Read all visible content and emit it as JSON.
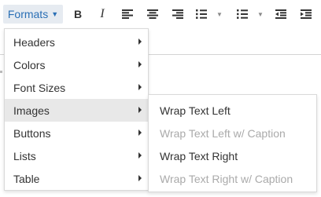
{
  "toolbar": {
    "formats_label": "Formats",
    "bold_label": "B",
    "italic_label": "I",
    "icons": [
      "align-left-icon",
      "align-center-icon",
      "align-right-icon",
      "bullet-list-icon",
      "numbered-list-icon",
      "outdent-icon",
      "indent-icon"
    ]
  },
  "menu": {
    "items": [
      {
        "label": "Headers"
      },
      {
        "label": "Colors"
      },
      {
        "label": "Font Sizes"
      },
      {
        "label": "Images"
      },
      {
        "label": "Buttons"
      },
      {
        "label": "Lists"
      },
      {
        "label": "Table"
      }
    ],
    "active_index": 3
  },
  "submenu": {
    "items": [
      {
        "label": "Wrap Text Left",
        "enabled": true
      },
      {
        "label": "Wrap Text Left w/ Caption",
        "enabled": false
      },
      {
        "label": "Wrap Text Right",
        "enabled": true
      },
      {
        "label": "Wrap Text Right w/ Caption",
        "enabled": false
      }
    ]
  },
  "colors": {
    "accent": "#2a6fb5",
    "active_bg": "#e8e8e8",
    "disabled_text": "#aaaaaa"
  }
}
